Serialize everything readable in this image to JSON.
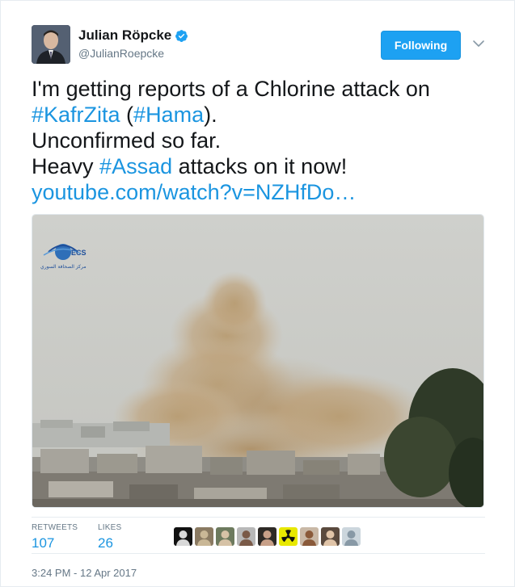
{
  "author": {
    "name": "Julian Röpcke",
    "handle": "@JulianRoepcke",
    "verified": true
  },
  "follow_button": {
    "label": "Following"
  },
  "tweet": {
    "lines": [
      [
        {
          "t": "I'm getting reports of a Chlorine attack on",
          "k": "text"
        }
      ],
      [
        {
          "t": "#KafrZita",
          "k": "hashtag"
        },
        {
          "t": " (",
          "k": "text"
        },
        {
          "t": "#Hama",
          "k": "hashtag"
        },
        {
          "t": ").",
          "k": "text"
        }
      ],
      [
        {
          "t": "Unconfirmed so far.",
          "k": "text"
        }
      ],
      [
        {
          "t": "Heavy ",
          "k": "text"
        },
        {
          "t": "#Assad",
          "k": "hashtag"
        },
        {
          "t": " attacks on it now!",
          "k": "text"
        }
      ],
      [
        {
          "t": " youtube.com/watch?v=NZHfDo…",
          "k": "link"
        }
      ]
    ]
  },
  "media": {
    "watermark": "ECS",
    "watermark_sub": "مركز الصحافة السوري"
  },
  "stats": {
    "retweets_label": "RETWEETS",
    "retweets_value": "107",
    "likes_label": "LIKES",
    "likes_value": "26"
  },
  "liker_avatars": [
    {
      "name": "liker-avatar-1",
      "bg": "#111111",
      "fg": "#d8d8d8"
    },
    {
      "name": "liker-avatar-2",
      "bg": "#8a7a62",
      "fg": "#c9b796"
    },
    {
      "name": "liker-avatar-3",
      "bg": "#6d7a5e",
      "fg": "#d6c2a6"
    },
    {
      "name": "liker-avatar-4",
      "bg": "#b8b8b8",
      "fg": "#7a5a48"
    },
    {
      "name": "liker-avatar-5",
      "bg": "#2e2a26",
      "fg": "#c8a088"
    },
    {
      "name": "liker-avatar-6",
      "bg": "#e8e800",
      "fg": "#111111"
    },
    {
      "name": "liker-avatar-7",
      "bg": "#c9b8a6",
      "fg": "#8a5a3a"
    },
    {
      "name": "liker-avatar-8",
      "bg": "#5a4a3e",
      "fg": "#e0c4a8"
    },
    {
      "name": "liker-avatar-9",
      "bg": "#ccd6dd",
      "fg": "#8899a6"
    }
  ],
  "timestamp": "3:24 PM - 12 Apr 2017",
  "colors": {
    "link": "#1b95e0",
    "follow_bg": "#1da1f2",
    "muted": "#657786",
    "text": "#14171a"
  }
}
